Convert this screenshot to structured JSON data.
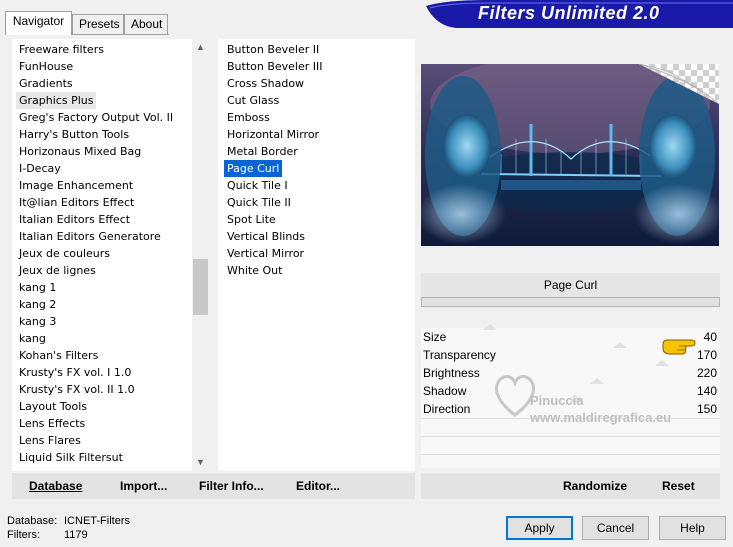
{
  "tabs": [
    {
      "label": "Navigator",
      "active": true
    },
    {
      "label": "Presets",
      "active": false
    },
    {
      "label": "About",
      "active": false
    }
  ],
  "banner": {
    "title": "Filters Unlimited 2.0",
    "color": "#1a1aa8"
  },
  "categories": {
    "items": [
      "Freeware filters",
      "FunHouse",
      "Gradients",
      "Graphics Plus",
      "Greg's Factory Output Vol. II",
      "Harry's Button Tools",
      "Horizonaus Mixed Bag",
      "I-Decay",
      "Image Enhancement",
      "It@lian Editors Effect",
      "Italian Editors Effect",
      "Italian Editors Generatore",
      "Jeux de couleurs",
      "Jeux de lignes",
      "kang 1",
      "kang 2",
      "kang 3",
      "kang",
      "Kohan's Filters",
      "Krusty's FX vol. I 1.0",
      "Krusty's FX vol. II 1.0",
      "Layout Tools",
      "Lens Effects",
      "Lens Flares",
      "Liquid Silk Filtersut"
    ],
    "selected_index": 3
  },
  "filters": {
    "items": [
      "Button Beveler II",
      "Button Beveler III",
      "Cross Shadow",
      "Cut Glass",
      "Emboss",
      "Horizontal Mirror",
      "Metal Border",
      "Page Curl",
      "Quick Tile I",
      "Quick Tile II",
      "Spot Lite",
      "Vertical Blinds",
      "Vertical Mirror",
      "White Out"
    ],
    "selected_index": 7,
    "selected_color": "#0a64d6"
  },
  "left_bar": {
    "database": "Database",
    "import": "Import...",
    "filter_info": "Filter Info...",
    "editor": "Editor..."
  },
  "right_bar": {
    "randomize": "Randomize",
    "reset": "Reset"
  },
  "filter_title": "Page Curl",
  "params": [
    {
      "label": "Size",
      "value": "40"
    },
    {
      "label": "Transparency",
      "value": "170"
    },
    {
      "label": "Brightness",
      "value": "220"
    },
    {
      "label": "Shadow",
      "value": "140"
    },
    {
      "label": "Direction",
      "value": "150"
    }
  ],
  "watermark": {
    "line1": "Pinuccia",
    "line2": "www.maldiregrafica.eu"
  },
  "status": {
    "db_label": "Database:",
    "db_value": "ICNET-Filters",
    "filters_label": "Filters:",
    "filters_value": "1179"
  },
  "buttons": {
    "apply": "Apply",
    "cancel": "Cancel",
    "help": "Help"
  }
}
